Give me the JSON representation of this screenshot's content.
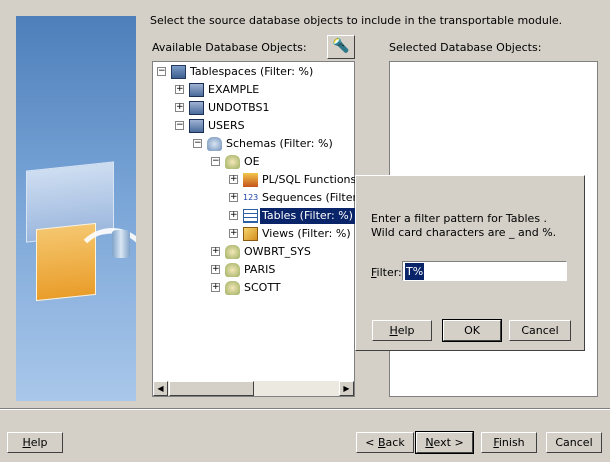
{
  "instruction": "Select the source database objects to include in the transportable module.",
  "available_label": "Available Database Objects:",
  "selected_label": "Selected Database Objects:",
  "filter_icon": "flashlight-icon",
  "tree": {
    "rows": [
      {
        "label": "Tablespaces  (Filter: %)",
        "expander": "−",
        "icon": "tablespaces-icon"
      },
      {
        "label": "EXAMPLE",
        "expander": "+",
        "icon": "tablespace-icon"
      },
      {
        "label": "UNDOTBS1",
        "expander": "+",
        "icon": "tablespace-icon"
      },
      {
        "label": "USERS",
        "expander": "−",
        "icon": "tablespace-icon"
      },
      {
        "label": "Schemas  (Filter: %)",
        "expander": "−",
        "icon": "schemas-icon"
      },
      {
        "label": "OE",
        "expander": "−",
        "icon": "schema-icon"
      },
      {
        "label": "PL/SQL Functions",
        "expander": "+",
        "icon": "plsql-icon"
      },
      {
        "label": "Sequences  (Filter:",
        "expander": "+",
        "icon": "sequence-icon"
      },
      {
        "label": "Tables  (Filter: %)",
        "expander": "+",
        "icon": "table-icon"
      },
      {
        "label": "Views  (Filter: %)",
        "expander": "+",
        "icon": "view-icon"
      },
      {
        "label": "OWBRT_SYS",
        "expander": "+",
        "icon": "schema-icon"
      },
      {
        "label": "PARIS",
        "expander": "+",
        "icon": "schema-icon"
      },
      {
        "label": "SCOTT",
        "expander": "+",
        "icon": "schema-icon"
      }
    ]
  },
  "dialog": {
    "message": "Enter a filter pattern for Tables . Wild card characters are _ and %.",
    "filter_label": "Filter:",
    "filter_value": "T%",
    "help": "Help",
    "ok": "OK",
    "cancel": "Cancel"
  },
  "footer": {
    "help": "Help",
    "back": "< Back",
    "next": "Next >",
    "finish": "Finish",
    "cancel": "Cancel"
  }
}
